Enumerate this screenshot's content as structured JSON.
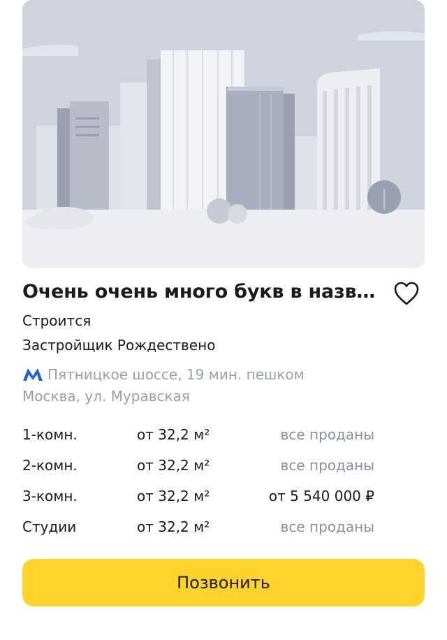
{
  "listing": {
    "title": "Очень очень много букв в назва...",
    "status": "Строится",
    "developer": "Застройщик Рождествено",
    "metro_text": "Пятницкое шоссе, 19 мин. пешком",
    "address": "Москва, ул. Муравская"
  },
  "rooms": [
    {
      "type": "1-комн.",
      "area": "от 32,2 м²",
      "price": "все проданы",
      "sold": true
    },
    {
      "type": "2-комн.",
      "area": "от 32,2 м²",
      "price": "все проданы",
      "sold": true
    },
    {
      "type": "3-комн.",
      "area": "от 32,2 м²",
      "price": "от 5 540 000 ₽",
      "sold": false
    },
    {
      "type": "Студии",
      "area": "от 32,2 м²",
      "price": "все проданы",
      "sold": true
    }
  ],
  "actions": {
    "call_label": "Позвонить"
  },
  "icons": {
    "favorite": "heart-outline-icon",
    "metro": "metro-m-icon"
  },
  "colors": {
    "accent": "#fed42b",
    "metro": "#1e63d6",
    "muted": "#9aa0a6"
  }
}
